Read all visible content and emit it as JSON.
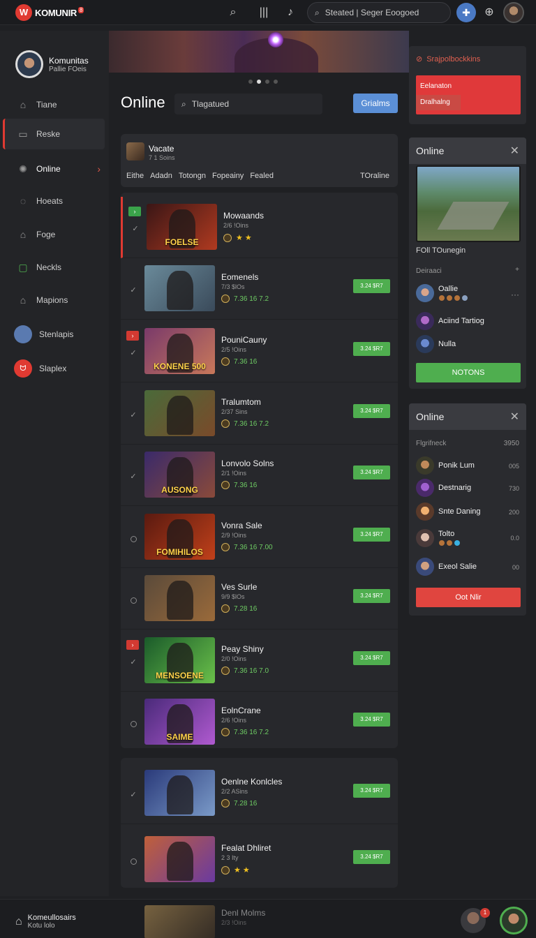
{
  "topbar": {
    "brand": "KOMUNIR",
    "brand_badge": "8",
    "search_placeholder": "Steated | Seger Eoogoed"
  },
  "sidebar": {
    "profile_name": "Komunitas",
    "profile_sub": "Pallie FOeis",
    "items": [
      {
        "label": "Tiane",
        "icon": "home-icon"
      },
      {
        "label": "Reske",
        "icon": "store-icon",
        "active": true
      },
      {
        "label": "Online",
        "icon": "globe-icon"
      },
      {
        "label": "Hoeats",
        "icon": "chat-icon"
      },
      {
        "label": "Foge",
        "icon": "house-icon"
      },
      {
        "label": "Neckls",
        "icon": "list-icon"
      },
      {
        "label": "Mapions",
        "icon": "map-icon"
      },
      {
        "label": "Stenlapis",
        "icon": "avatar"
      },
      {
        "label": "Slaplex",
        "icon": "brand-badge"
      }
    ]
  },
  "main": {
    "title": "Online",
    "search_placeholder": "Tlagatued",
    "action_button": "Grialms",
    "filter_card": {
      "title": "Vacate",
      "subtitle": "7 1 Soins",
      "tabs": [
        "Eithe",
        "Adadn",
        "Totongn",
        "Fopeainy",
        "Fealed"
      ],
      "right_label": "TOraline"
    },
    "rows": [
      {
        "title": "Mowaands",
        "sub": "2/6 !Oins",
        "stats": "★ ★",
        "pill": "",
        "mark": "green",
        "state": "check",
        "thumb_label": "FOELSE",
        "colors": [
          "#3a1616",
          "#b03a20"
        ]
      },
      {
        "title": "Eomenels",
        "sub": "7/3 $lOs",
        "stats": "7.36  16  7.2",
        "pill": "3.24 $R7",
        "mark": "",
        "state": "check",
        "thumb_label": "",
        "colors": [
          "#6a8a9a",
          "#3a4a5a"
        ]
      },
      {
        "title": "PouniCauny",
        "sub": "2/5 !Oins",
        "stats": "7.36  16",
        "pill": "3.24 $R7",
        "mark": "red",
        "state": "check",
        "thumb_label": "KONENE 500",
        "colors": [
          "#7a3a6a",
          "#c8785a"
        ]
      },
      {
        "title": "Tralumtom",
        "sub": "2/37 Sins",
        "stats": "7.36  16  7.2",
        "pill": "3.24 $R7",
        "mark": "",
        "state": "check",
        "thumb_label": "",
        "colors": [
          "#4a6a3a",
          "#7a4a2a"
        ]
      },
      {
        "title": "Lonvolo Solns",
        "sub": "2/1 !Oins",
        "stats": "7.36  16",
        "pill": "3.24 $R7",
        "mark": "",
        "state": "check",
        "thumb_label": "AUSONG",
        "colors": [
          "#3a2a6a",
          "#8a4a3a"
        ]
      },
      {
        "title": "Vonra Sale",
        "sub": "2/9 !Oins",
        "stats": "7.36  16  7.00",
        "pill": "3.24 $R7",
        "mark": "",
        "state": "circle",
        "thumb_label": "FOMIHILOS",
        "colors": [
          "#5a1a10",
          "#c0401a"
        ]
      },
      {
        "title": "Ves Surle",
        "sub": "9/9 $lOs",
        "stats": "7.28  16",
        "pill": "3.24 $R7",
        "mark": "",
        "state": "circle",
        "thumb_label": "",
        "colors": [
          "#5a4a3a",
          "#9a6a3a"
        ]
      },
      {
        "title": "Peay Shiny",
        "sub": "2/0 !Oins",
        "stats": "7.36  16  7.0",
        "pill": "3.24 $R7",
        "mark": "red",
        "state": "check",
        "thumb_label": "MENSOENE",
        "colors": [
          "#1a5a2a",
          "#6ac04a"
        ]
      },
      {
        "title": "EolnCrane",
        "sub": "2/6 !Oins",
        "stats": "7.36  16  7.2",
        "pill": "3.24 $R7",
        "mark": "",
        "state": "circle",
        "thumb_label": "SAIME",
        "colors": [
          "#4a2a7a",
          "#b05ad0"
        ]
      },
      {
        "title": "Oenlne Konlcles",
        "sub": "2/2 ASins",
        "stats": "7.28  16",
        "pill": "3.24 $R7",
        "mark": "",
        "state": "check",
        "thumb_label": "",
        "colors": [
          "#2a3a7a",
          "#7a9ac8"
        ]
      },
      {
        "title": "Fealat Dhliret",
        "sub": "2 3 Ity",
        "stats": "★ ★",
        "pill": "3.24 $R7",
        "mark": "",
        "state": "circle",
        "thumb_label": "",
        "colors": [
          "#c0603a",
          "#6a3aa0"
        ]
      }
    ],
    "footer_row": {
      "title": "Denl Molms",
      "sub": "2/3 !Oins"
    }
  },
  "right": {
    "promo": {
      "header": "Srajpolbockkins",
      "line1": "Eelanaton",
      "line2": "Dralhalng"
    },
    "online_panel": {
      "title": "Online",
      "caption": "FOll TOunegin",
      "section": "Deiraaci",
      "section_right": "+",
      "users": [
        {
          "name": "Oallie",
          "more": "···"
        },
        {
          "name": "Aciind Tartiog"
        },
        {
          "name": "Nulla"
        }
      ],
      "button": "NOTONS",
      "button_color": "#4fae4f"
    },
    "online_panel2": {
      "title": "Online",
      "section": "Flgrifneck",
      "section_right": "3950",
      "users": [
        {
          "name": "Ponik Lum",
          "value": "005"
        },
        {
          "name": "Destnarig",
          "value": "730"
        },
        {
          "name": "Snte Daning",
          "value": "200"
        },
        {
          "name": "Tolto",
          "value": "0.0"
        },
        {
          "name": "Exeol Salie",
          "value": "00"
        }
      ],
      "button": "Oot Nlir",
      "button_color": "#e0453f"
    }
  },
  "bottombar": {
    "title": "Komeullosairs",
    "sub": "Kotu lolo",
    "notif_count": "1"
  }
}
